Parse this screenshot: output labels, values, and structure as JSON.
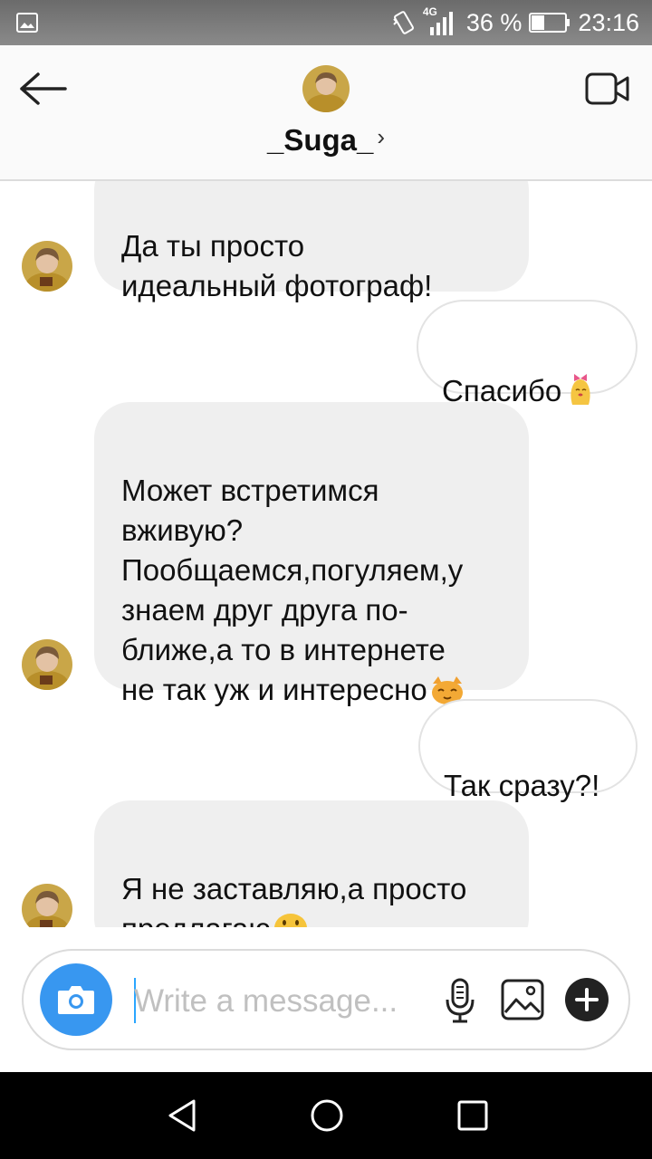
{
  "status_bar": {
    "network_type": "4G",
    "battery": "36 %",
    "time": "23:16",
    "icons": [
      "gallery-icon",
      "vibrate-icon",
      "signal-icon",
      "battery-icon"
    ]
  },
  "header": {
    "username": "_Suga_",
    "chevron": "›",
    "icons": [
      "back-arrow-icon",
      "video-call-icon",
      "avatar"
    ]
  },
  "messages": [
    {
      "from": "them",
      "text": "Да ты просто\nидеальный фотограф!"
    },
    {
      "from": "me",
      "text": "Спасибо",
      "emoji": "bow-character-emoji"
    },
    {
      "from": "them",
      "text": "Может встретимся\nвживую?\nПообщаемся,погуляем,у\nзнаем друг друга по-\nближе,а то в интернете\nне так уж и интересно",
      "emoji": "cat-emoji"
    },
    {
      "from": "me",
      "text": "Так сразу?!"
    },
    {
      "from": "them",
      "text": "Я не заставляю,а просто\nпредлагаю",
      "emoji": "grinning-face-emoji"
    }
  ],
  "composer": {
    "placeholder": "Write a message...",
    "value": "",
    "icons": [
      "camera-icon",
      "microphone-icon",
      "gallery-icon",
      "plus-icon"
    ]
  },
  "navbar": {
    "icons": [
      "back-triangle-icon",
      "home-circle-icon",
      "recents-square-icon"
    ]
  },
  "colors": {
    "accent_blue": "#3897f0",
    "incoming_bubble": "#efefef",
    "header_bg": "#fafafa",
    "navbar_bg": "#000000"
  }
}
